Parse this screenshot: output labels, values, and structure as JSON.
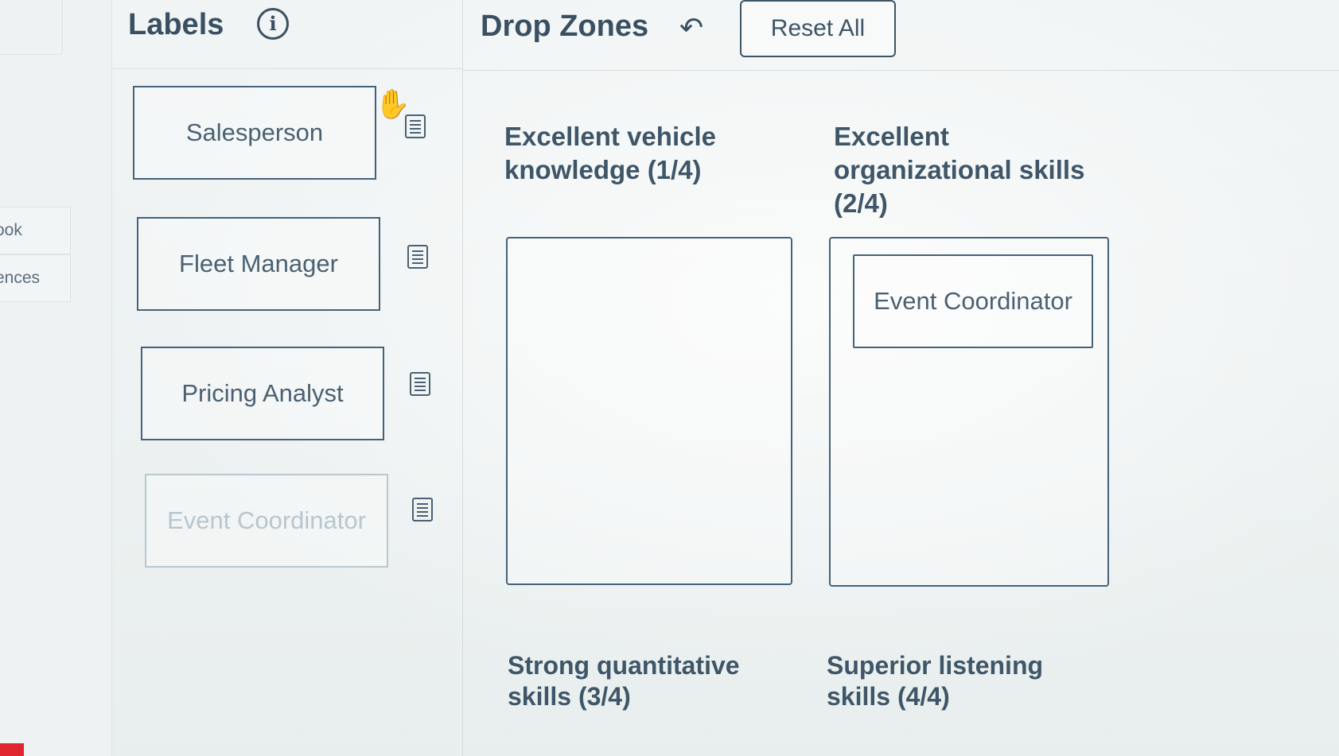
{
  "sidebar": {
    "items": [
      {
        "label": "ook"
      },
      {
        "label": "ences"
      }
    ]
  },
  "labels_panel": {
    "title": "Labels",
    "info_icon": "i",
    "cards": [
      {
        "label": "Salesperson",
        "state": "available"
      },
      {
        "label": "Fleet Manager",
        "state": "available"
      },
      {
        "label": "Pricing Analyst",
        "state": "available"
      },
      {
        "label": "Event Coordinator",
        "state": "used"
      }
    ]
  },
  "drop_zones_panel": {
    "title": "Drop Zones",
    "undo_icon": "↶",
    "reset_label": "Reset All",
    "zones": [
      {
        "heading": "Excellent vehicle knowledge (1/4)",
        "placed": ""
      },
      {
        "heading": "Excellent organizational skills (2/4)",
        "placed": "Event Coordinator"
      },
      {
        "heading": "Strong quantitative skills (3/4)",
        "placed": ""
      },
      {
        "heading": "Superior listening skills (4/4)",
        "placed": ""
      }
    ]
  },
  "colors": {
    "text": "#3e5566",
    "border": "#44627a",
    "dim": "#b8c6ce",
    "accent_red": "#e2262f"
  }
}
